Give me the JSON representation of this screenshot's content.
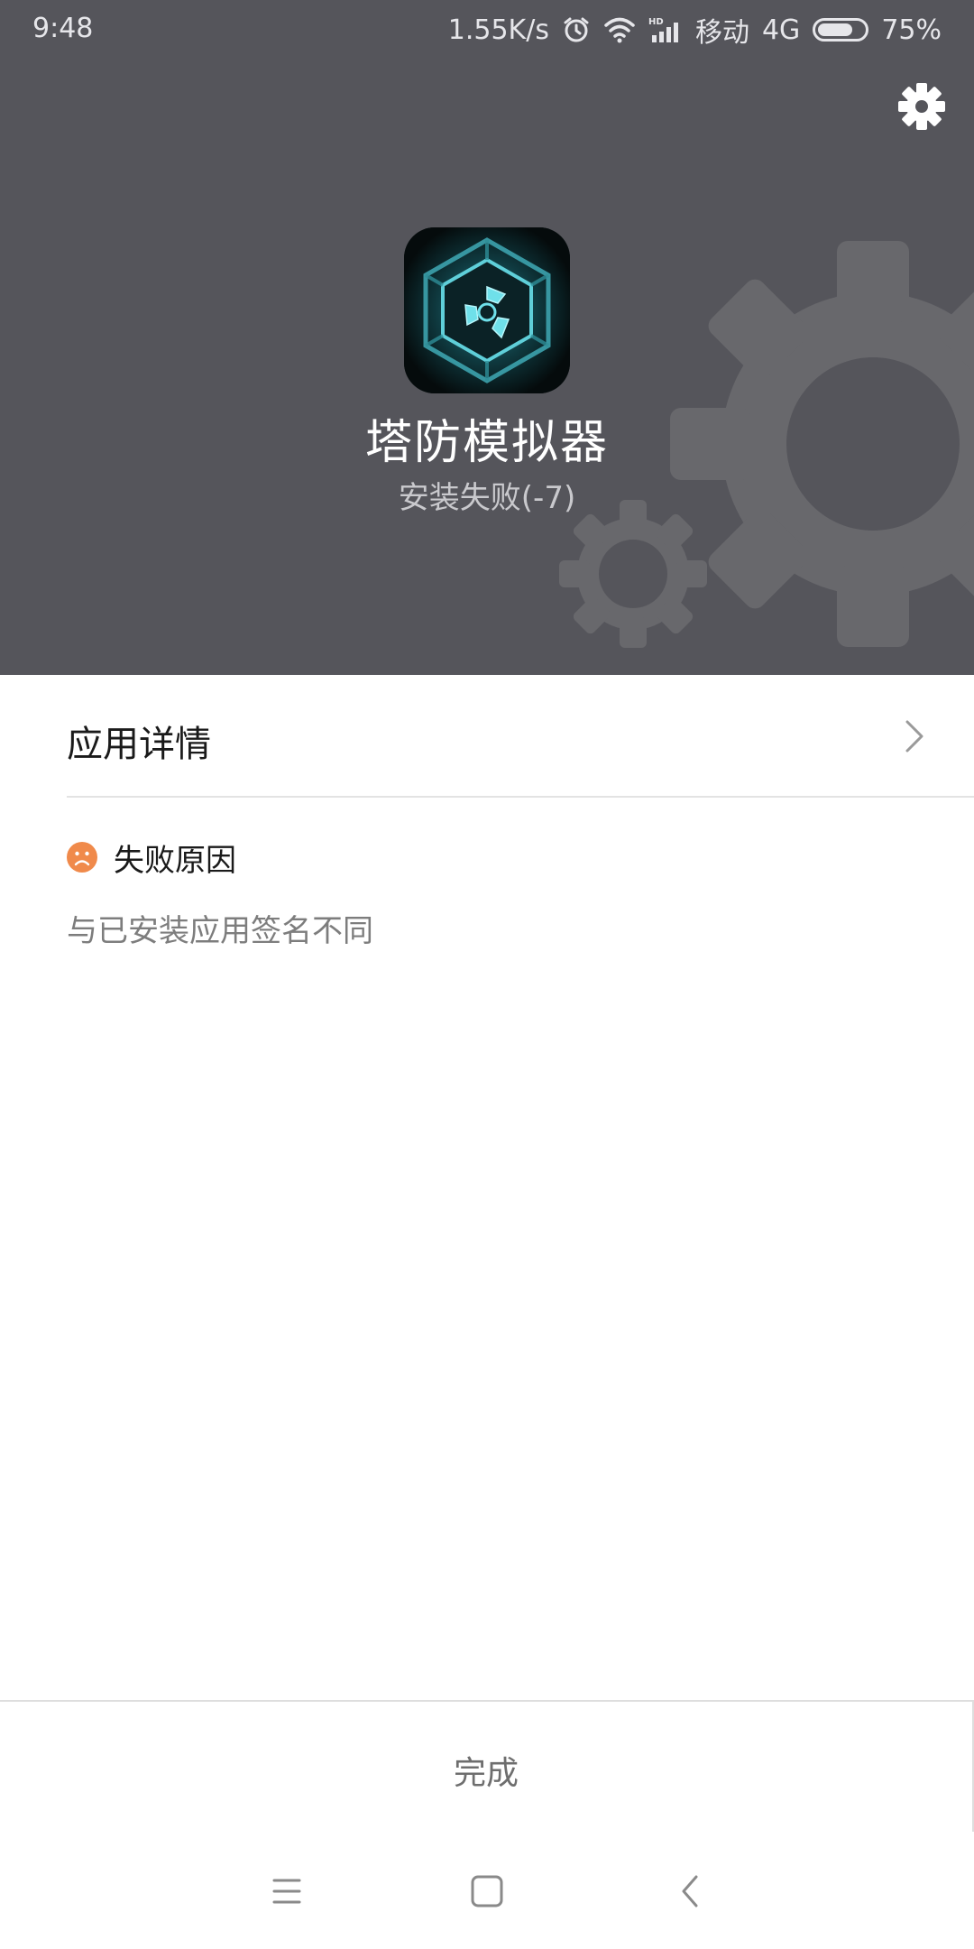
{
  "status_bar": {
    "time": "9:48",
    "network_speed": "1.55K/s",
    "carrier": "移动",
    "network_type": "4G",
    "battery_percent": "75%",
    "battery_level": 0.75,
    "icons": [
      "alarm-icon",
      "wifi-icon",
      "hd-signal-icon",
      "battery-icon"
    ]
  },
  "header": {
    "settings_icon": "gear-icon",
    "app_icon": "tower-defense-app-icon",
    "app_name": "塔防模拟器",
    "install_status": "安装失败(-7)",
    "background_color": "#55555b"
  },
  "details": {
    "label": "应用详情",
    "chevron_icon": "chevron-right-icon"
  },
  "failure": {
    "icon": "sad-face-icon",
    "icon_color": "#f08a4b",
    "title": "失败原因",
    "reason": "与已安装应用签名不同"
  },
  "footer": {
    "done_label": "完成"
  },
  "nav_bar": {
    "icons": [
      "menu-icon",
      "home-icon",
      "back-icon"
    ]
  }
}
